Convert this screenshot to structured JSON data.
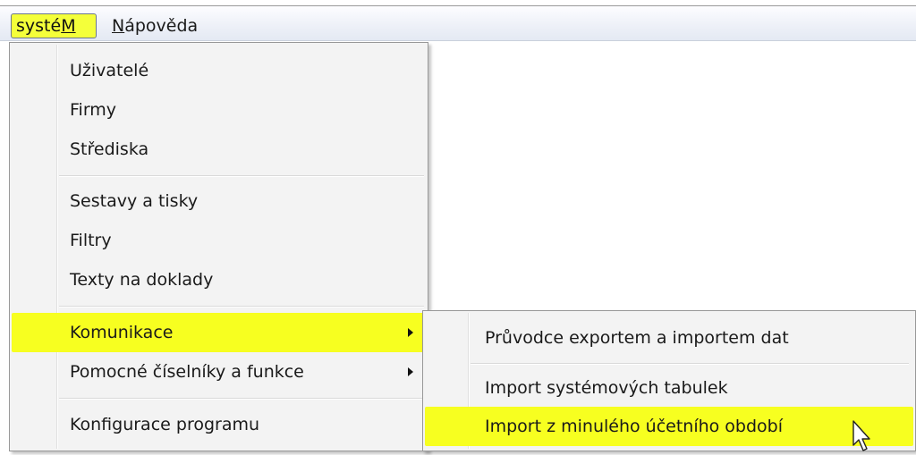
{
  "menubar": {
    "system_label_pre": "systé",
    "system_label_mnemonic": "M",
    "help_label_mnemonic": "N",
    "help_label_rest": "ápověda"
  },
  "system_menu": {
    "items": [
      {
        "label": "Uživatelé"
      },
      {
        "label": "Firmy"
      },
      {
        "label": "Střediska"
      },
      {
        "label": "Sestavy a tisky"
      },
      {
        "label": "Filtry"
      },
      {
        "label": "Texty na doklady"
      },
      {
        "label": "Komunikace",
        "submenu": true,
        "highlighted": true
      },
      {
        "label": "Pomocné číselníky a funkce",
        "submenu": true
      },
      {
        "label": "Konfigurace programu"
      }
    ]
  },
  "communication_submenu": {
    "items": [
      {
        "label": "Průvodce exportem a importem dat"
      },
      {
        "label": "Import systémových tabulek"
      },
      {
        "label": "Import z minulého účetního období",
        "highlighted": true
      }
    ]
  },
  "colors": {
    "highlight": "#f7ff20",
    "menu_bg": "#f3f3f3",
    "menubar_bg": "#eef1f8"
  },
  "icons": {
    "submenu_arrow": "chevron-right-icon",
    "pointer": "mouse-pointer-icon"
  }
}
